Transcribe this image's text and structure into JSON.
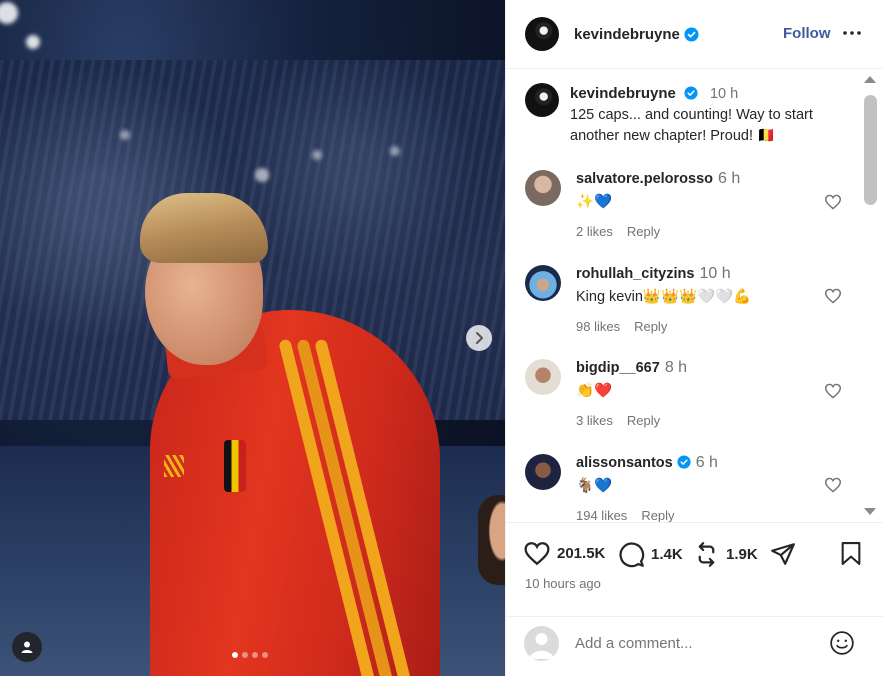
{
  "post_author": {
    "username": "kevindebruyne",
    "verified": true,
    "follow_label": "Follow"
  },
  "caption": {
    "username": "kevindebruyne",
    "time": "10 h",
    "text": "125 caps... and counting! Way to start another new chapter! Proud! 🇧🇪"
  },
  "comments": [
    {
      "username": "salvatore.pelorosso",
      "verified": false,
      "time": "6 h",
      "text": "✨💙",
      "likes": "2 likes",
      "reply": "Reply"
    },
    {
      "username": "rohullah_cityzins",
      "verified": false,
      "time": "10 h",
      "text": "King kevin👑👑👑🤍🤍💪",
      "likes": "98 likes",
      "reply": "Reply"
    },
    {
      "username": "bigdip__667",
      "verified": false,
      "time": "8 h",
      "text": "👏❤️",
      "likes": "3 likes",
      "reply": "Reply"
    },
    {
      "username": "alissonsantos",
      "verified": true,
      "time": "6 h",
      "text": "🐐💙",
      "likes": "194 likes",
      "reply": "Reply"
    }
  ],
  "actions": {
    "likes": "201.5K",
    "comments": "1.4K",
    "reposts": "1.9K"
  },
  "posted_ago": "10 hours ago",
  "add_comment_placeholder": "Add a comment...",
  "colors": {
    "verified": "#0095f6",
    "follow": "#3f5a9e",
    "muted": "#737373"
  },
  "carousel": {
    "slides": 4,
    "active_index": 0
  }
}
